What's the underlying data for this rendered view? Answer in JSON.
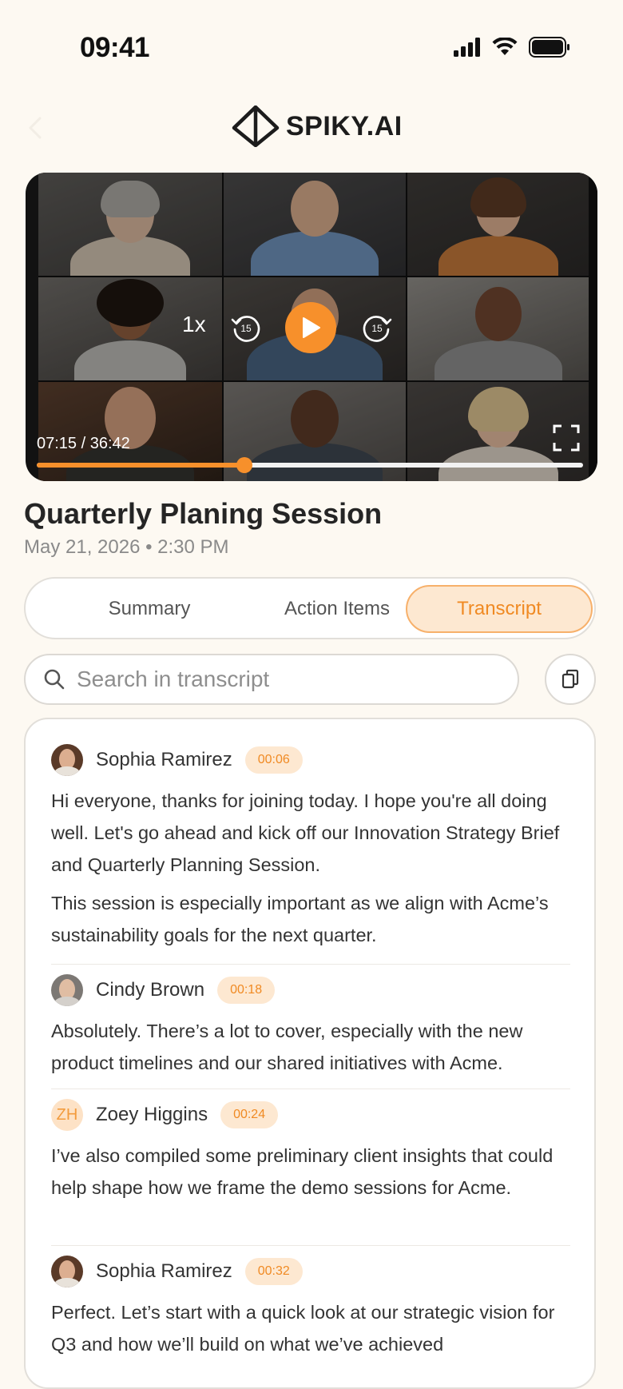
{
  "status_bar": {
    "time": "09:41"
  },
  "header": {
    "brand": "SPIKY.AI"
  },
  "video": {
    "speed": "1x",
    "skip_back_seconds": "15",
    "skip_forward_seconds": "15",
    "timecode": "07:15 / 36:42",
    "progress": 0.38
  },
  "meeting": {
    "title": "Quarterly Planing Session",
    "meta": "May 21, 2026 • 2:30 PM"
  },
  "tabs": [
    {
      "label": "Summary",
      "active": false
    },
    {
      "label": "Action Items",
      "active": false
    },
    {
      "label": "Transcript",
      "active": true
    }
  ],
  "search": {
    "placeholder": "Search in transcript"
  },
  "transcript": [
    {
      "speaker": "Sophia Ramirez",
      "time": "00:06",
      "avatar": "photo",
      "paragraphs": [
        "Hi everyone, thanks for joining today. I hope you're all doing well. Let's go ahead and kick off our Innovation Strategy Brief and Quarterly Planning Session.",
        "This session is especially important as we align with Acme’s sustainability goals for the next quarter."
      ]
    },
    {
      "speaker": "Cindy Brown",
      "time": "00:18",
      "avatar": "photo",
      "paragraphs": [
        "Absolutely. There’s a lot to cover, especially with the new product timelines and our shared initiatives with Acme."
      ]
    },
    {
      "speaker": "Zoey Higgins",
      "time": "00:24",
      "avatar": "initials",
      "initials": "ZH",
      "paragraphs": [
        "I’ve also compiled some preliminary client insights that could help shape how we frame the demo sessions for Acme."
      ]
    },
    {
      "speaker": "Sophia Ramirez",
      "time": "00:32",
      "avatar": "photo",
      "paragraphs": [
        "Perfect. Let’s start with a quick look at our strategic vision for Q3 and how we’ll build on what we’ve achieved"
      ]
    }
  ],
  "colors": {
    "accent": "#f7902b",
    "background": "#fdf9f2"
  }
}
